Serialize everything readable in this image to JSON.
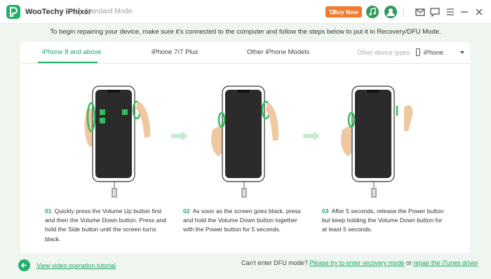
{
  "app": {
    "name": "WooTechy iPhixer",
    "mode": "Standard Mode",
    "buy_label": "Buy Now"
  },
  "instruction": "To begin repairing your device, make sure it's connected to the computer and follow the steps below to put it in Recovery/DFU Mode.",
  "tabs": [
    {
      "label": "iPhone 8 and above",
      "active": true
    },
    {
      "label": "iPhone 7/7 Plus",
      "active": false
    },
    {
      "label": "Other iPhone Models",
      "active": false
    }
  ],
  "device_type": {
    "label": "Other device types:",
    "value": "iPhone"
  },
  "steps": [
    {
      "num": "01",
      "text": "Quickly press the Volume Up button first and then the Volume Down button. Press and hold the Side button until the screen turns black."
    },
    {
      "num": "02",
      "text": "As soon as the screen goes black, press and hold the Volume Down button together with the Power button for 5 seconds."
    },
    {
      "num": "03",
      "text": "After 5 seconds, release the Power button but keep holding the Volume Down button for at least 5 seconds."
    }
  ],
  "footer": {
    "video_link": "View video operation tutorial",
    "question": "Can't enter DFU mode?",
    "recovery_link": "Please try to enter recovery mode",
    "or": "or",
    "itunes_link": "repair the iTunes driver"
  },
  "colors": {
    "accent": "#20b26b",
    "buy": "#f07a2e",
    "phone_screen": "#2b2b2b"
  }
}
